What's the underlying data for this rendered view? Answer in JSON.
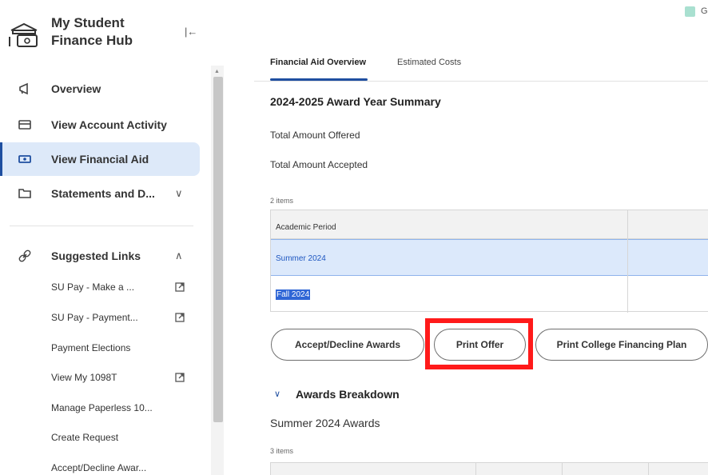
{
  "sidebar": {
    "title": "My Student Finance Hub",
    "collapse_glyph": "|←",
    "nav": [
      {
        "label": "Overview",
        "icon": "megaphone-icon"
      },
      {
        "label": "View Account Activity",
        "icon": "card-icon"
      },
      {
        "label": "View Financial Aid",
        "icon": "cash-icon",
        "active": true
      },
      {
        "label": "Statements and D...",
        "icon": "folder-icon",
        "chevron": "∨"
      }
    ],
    "suggested": {
      "label": "Suggested Links",
      "icon": "link-icon",
      "chevron": "∧",
      "links": [
        {
          "label": "SU Pay - Make a ...",
          "external": true
        },
        {
          "label": "SU Pay - Payment...",
          "external": true
        },
        {
          "label": "Payment Elections",
          "external": false
        },
        {
          "label": "View My 1098T",
          "external": true
        },
        {
          "label": "Manage Paperless 10...",
          "external": false
        },
        {
          "label": "Create Request",
          "external": false
        },
        {
          "label": "Accept/Decline Awar...",
          "external": false
        }
      ]
    }
  },
  "legend": {
    "label": "Ge",
    "color": "#a9e0d0"
  },
  "tabs": [
    {
      "label": "Financial Aid Overview",
      "active": true
    },
    {
      "label": "Estimated Costs",
      "active": false
    }
  ],
  "summary": {
    "title": "2024-2025 Award Year Summary",
    "total_offered_label": "Total Amount Offered",
    "total_accepted_label": "Total Amount Accepted"
  },
  "periods_table": {
    "count": "2 items",
    "header": "Academic Period",
    "rows": [
      "Summer 2024",
      "Fall 2024"
    ]
  },
  "buttons": {
    "accept_decline": "Accept/Decline Awards",
    "print_offer": "Print Offer",
    "print_college_plan": "Print College Financing Plan"
  },
  "breakdown": {
    "chevron": "∨",
    "title": "Awards Breakdown",
    "subtitle": "Summer 2024 Awards",
    "count": "3 items"
  },
  "colors": {
    "accent": "#1f4fa0",
    "selected_row": "#dce9fb",
    "highlight_border": "#ff1a1a"
  }
}
